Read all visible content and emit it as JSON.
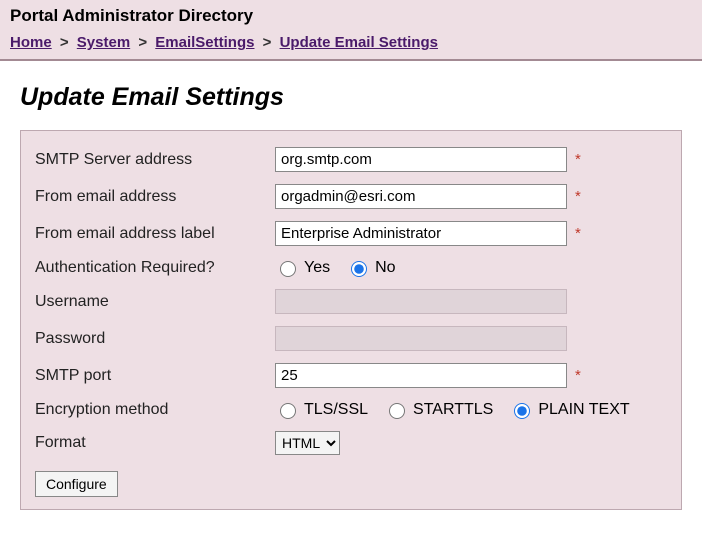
{
  "header": {
    "app_title": "Portal Administrator Directory"
  },
  "breadcrumb": {
    "home": "Home",
    "system": "System",
    "email_settings": "EmailSettings",
    "current": "Update Email Settings",
    "sep": ">"
  },
  "page": {
    "title": "Update Email Settings"
  },
  "form": {
    "smtp_server": {
      "label": "SMTP Server address",
      "value": "org.smtp.com",
      "required": "*"
    },
    "from_email": {
      "label": "From email address",
      "value": "orgadmin@esri.com",
      "required": "*"
    },
    "from_label": {
      "label": "From email address label",
      "value": "Enterprise Administrator",
      "required": "*"
    },
    "auth_required": {
      "label": "Authentication Required?",
      "yes": "Yes",
      "no": "No",
      "selected": "no"
    },
    "username": {
      "label": "Username",
      "value": ""
    },
    "password": {
      "label": "Password",
      "value": ""
    },
    "smtp_port": {
      "label": "SMTP port",
      "value": "25",
      "required": "*"
    },
    "encryption": {
      "label": "Encryption method",
      "tls": "TLS/SSL",
      "starttls": "STARTTLS",
      "plain": "PLAIN TEXT",
      "selected": "plain"
    },
    "format": {
      "label": "Format",
      "selected": "HTML"
    },
    "submit": "Configure"
  }
}
